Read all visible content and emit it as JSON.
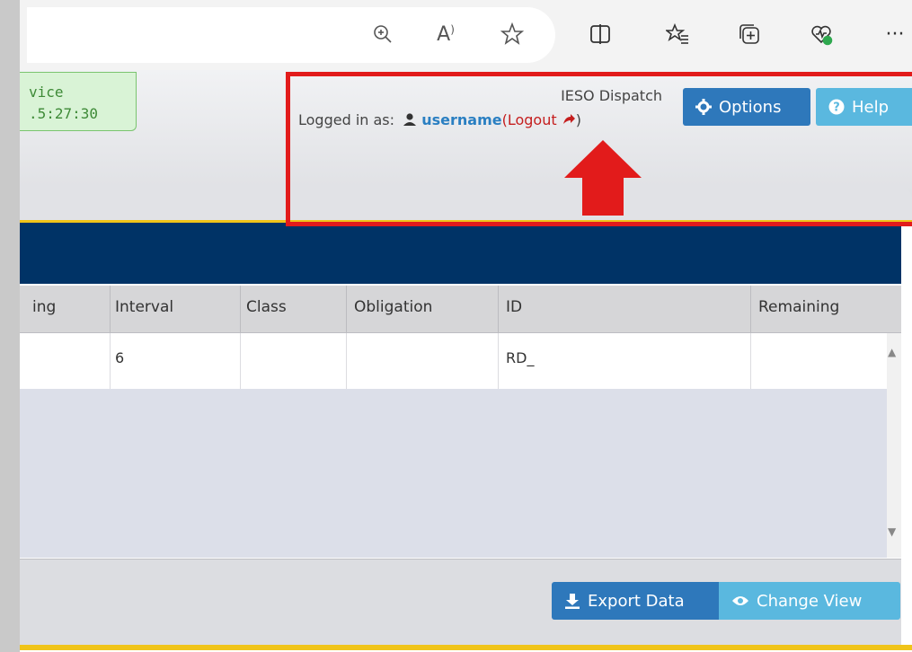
{
  "browser": {
    "icons": [
      "zoom-icon",
      "read-aloud-icon",
      "favorite-star-icon",
      "split-screen-icon",
      "favorites-list-icon",
      "collections-icon",
      "browser-essentials-icon",
      "more-icon"
    ],
    "read_aloud_glyph": "A",
    "more_glyph": "···"
  },
  "header": {
    "service_line1": "vice",
    "service_line2": ".5:27:30",
    "app_name": "IESO Dispatch",
    "logged_in_prefix": "Logged in as:",
    "username": "username",
    "logout_label": "Logout",
    "options_label": "Options",
    "help_label": "Help"
  },
  "table": {
    "columns": [
      "ing",
      "Interval",
      "Class",
      "Obligation",
      "ID",
      "Remaining"
    ],
    "rows": [
      [
        "",
        "6",
        "",
        "",
        "RD_",
        ""
      ]
    ]
  },
  "footer": {
    "export_label": "Export Data",
    "change_view_label": "Change View"
  },
  "colors": {
    "annotation": "#e21b1b",
    "navy": "#003366",
    "accent_yellow": "#f0c419",
    "primary_button": "#2e78bb",
    "info_button": "#5ab8df"
  }
}
